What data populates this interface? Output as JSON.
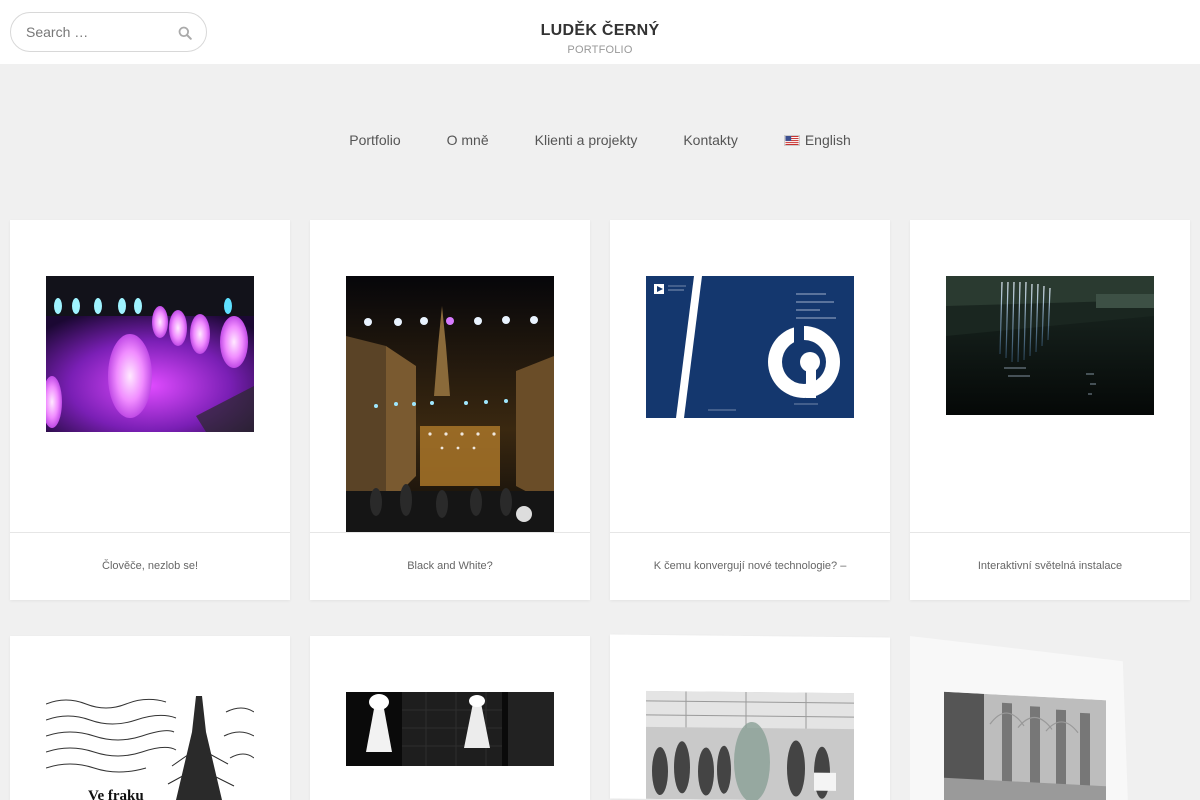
{
  "header": {
    "search_placeholder": "Search …",
    "site_title": "LUDĚK ČERNÝ",
    "site_tagline": "PORTFOLIO"
  },
  "nav": {
    "items": [
      "Portfolio",
      "O mně",
      "Klienti a projekty",
      "Kontakty"
    ],
    "language": "English"
  },
  "portfolio": {
    "captions": [
      "Člověče, nezlob se!",
      "Black and White?",
      "K čemu konvergují nové technologie? –",
      "Interaktivní světelná instalace"
    ],
    "book_cover_title": "K čemu konvergují nové technologie?",
    "artwork_text": "Ve fraku"
  },
  "colors": {
    "background": "#f0f0f0",
    "card": "#ffffff",
    "book_blue": "#14376e"
  }
}
